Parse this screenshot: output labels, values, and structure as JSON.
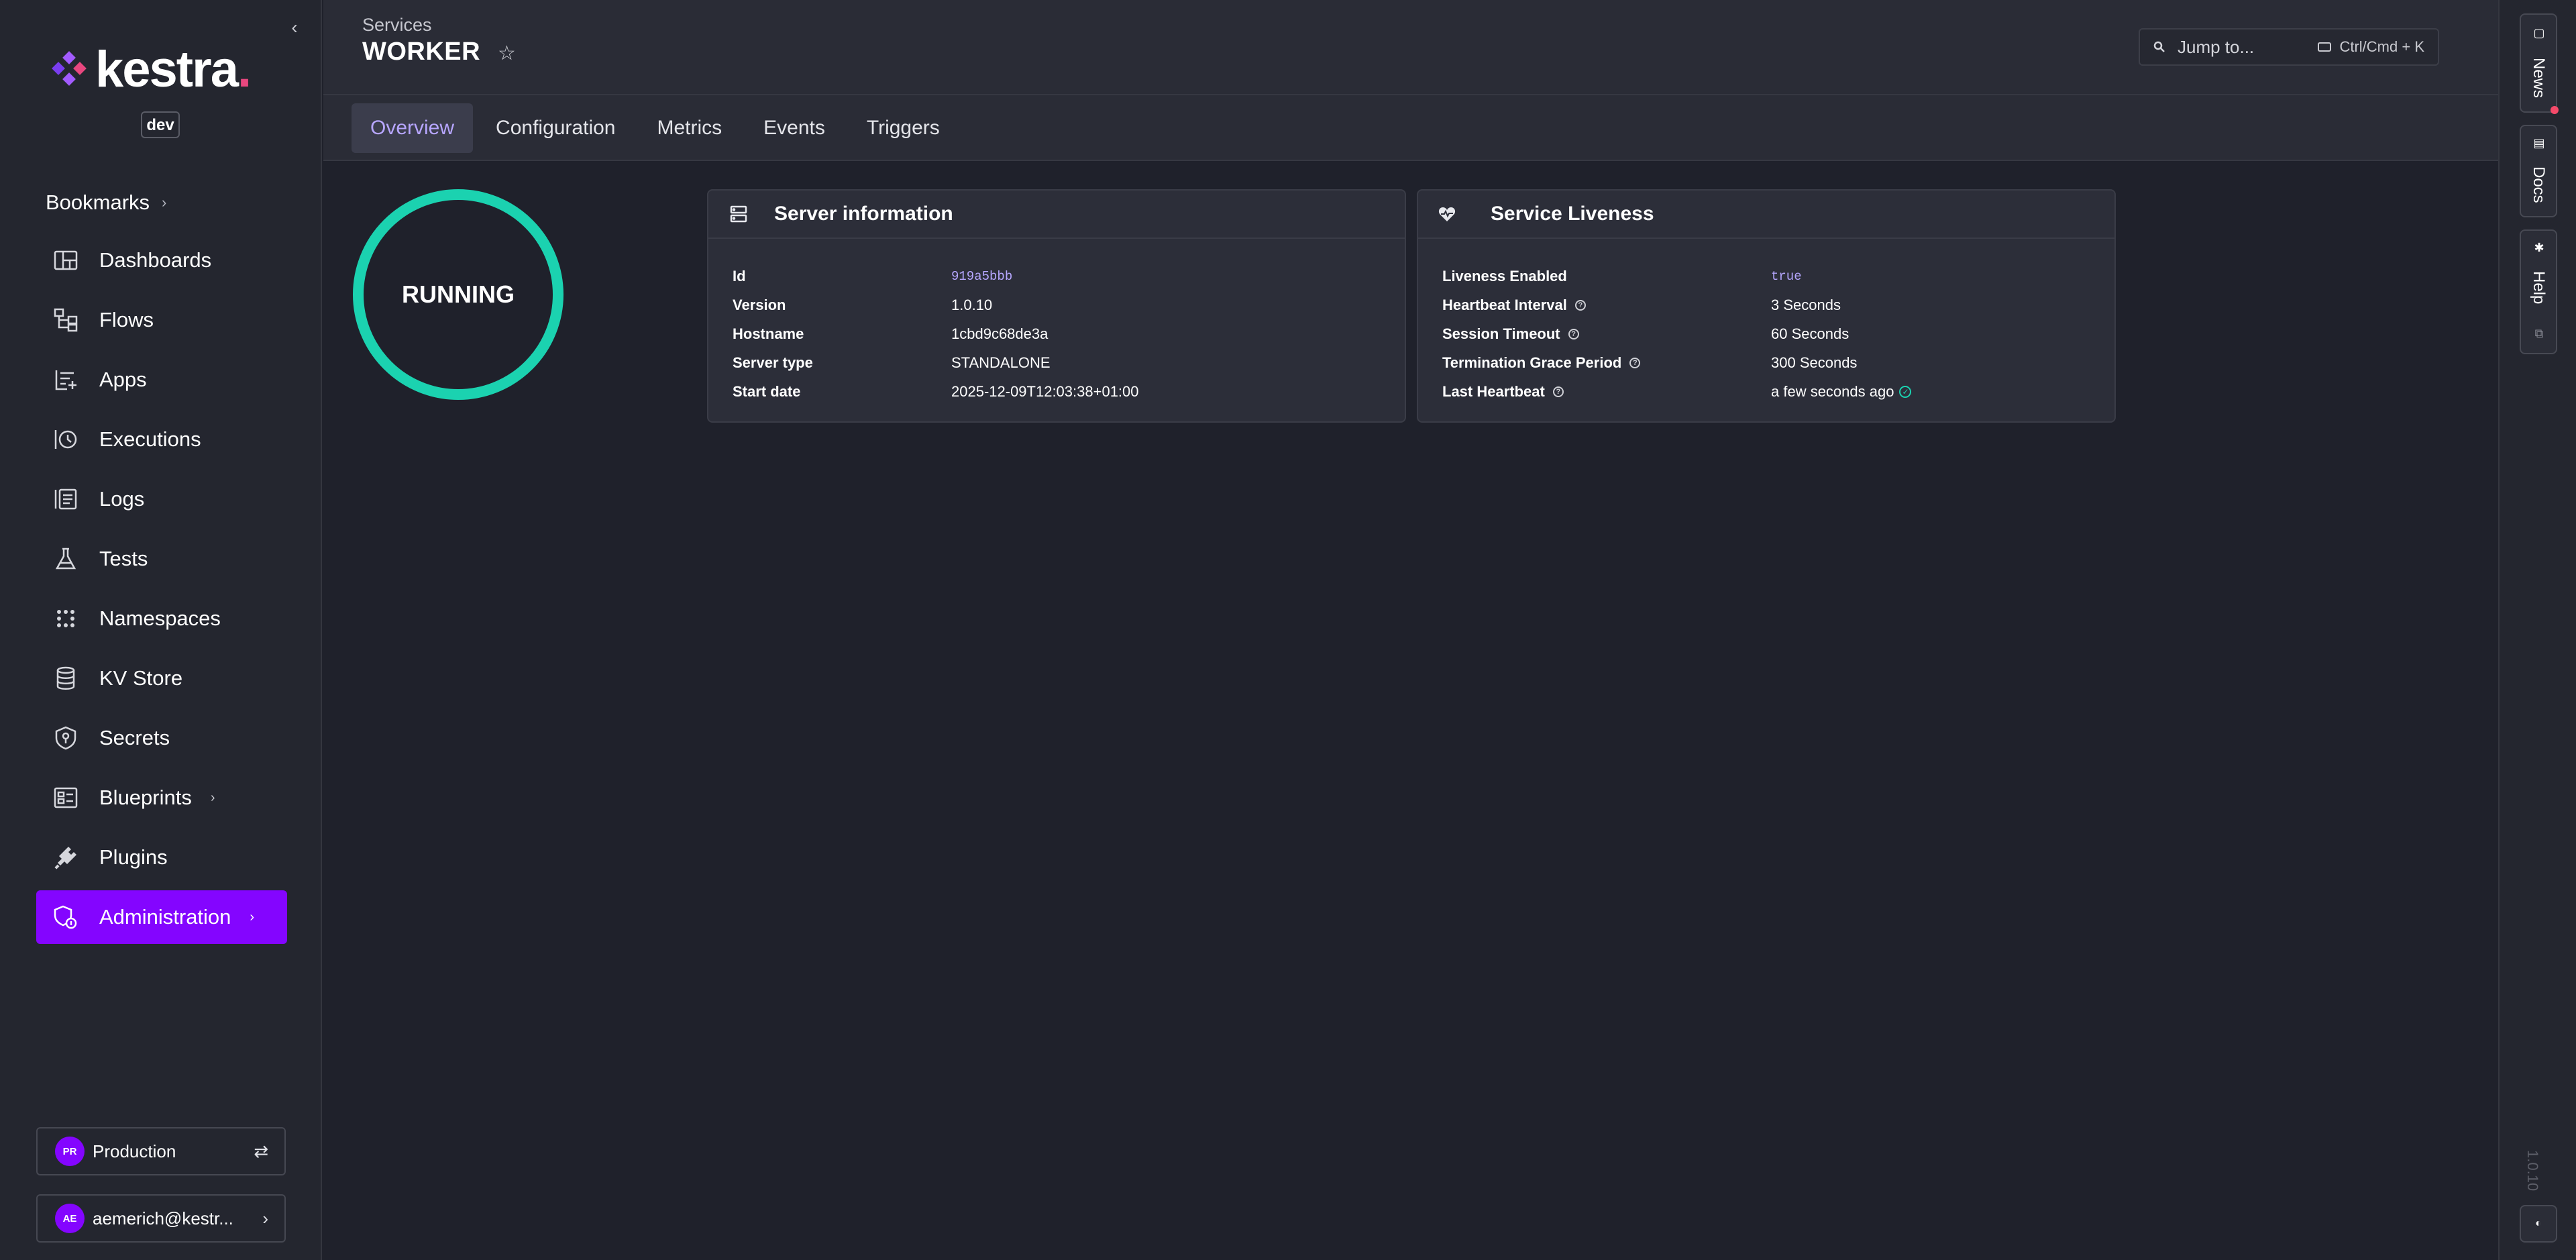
{
  "sidebar": {
    "logo_text": "kestra",
    "env_badge": "dev",
    "bookmarks_label": "Bookmarks",
    "items": [
      {
        "label": "Dashboards",
        "icon": "dashboard-icon"
      },
      {
        "label": "Flows",
        "icon": "flow-icon"
      },
      {
        "label": "Apps",
        "icon": "apps-icon"
      },
      {
        "label": "Executions",
        "icon": "history-icon"
      },
      {
        "label": "Logs",
        "icon": "logs-icon"
      },
      {
        "label": "Tests",
        "icon": "flask-icon"
      },
      {
        "label": "Namespaces",
        "icon": "grid-dots-icon"
      },
      {
        "label": "KV Store",
        "icon": "database-icon"
      },
      {
        "label": "Secrets",
        "icon": "shield-key-icon"
      },
      {
        "label": "Blueprints",
        "icon": "blueprint-icon"
      },
      {
        "label": "Plugins",
        "icon": "plug-icon"
      },
      {
        "label": "Administration",
        "icon": "shield-admin-icon"
      }
    ],
    "tenant": {
      "initials": "PR",
      "name": "Production"
    },
    "user": {
      "initials": "AE",
      "name": "aemerich@kestr..."
    }
  },
  "header": {
    "breadcrumb": "Services",
    "title": "WORKER",
    "search": {
      "placeholder": "Jump to...",
      "shortcut": "Ctrl/Cmd + K"
    }
  },
  "tabs": [
    "Overview",
    "Configuration",
    "Metrics",
    "Events",
    "Triggers"
  ],
  "status": {
    "label": "RUNNING",
    "color": "#1bd2b0"
  },
  "server_info": {
    "title": "Server information",
    "rows": [
      {
        "key": "Id",
        "value": "919a5bbb"
      },
      {
        "key": "Version",
        "value": "1.0.10"
      },
      {
        "key": "Hostname",
        "value": "1cbd9c68de3a"
      },
      {
        "key": "Server type",
        "value": "STANDALONE"
      },
      {
        "key": "Start date",
        "value": "2025-12-09T12:03:38+01:00"
      }
    ]
  },
  "liveness": {
    "title": "Service Liveness",
    "rows": [
      {
        "key": "Liveness Enabled",
        "value": "true"
      },
      {
        "key": "Heartbeat Interval",
        "value": "3 Seconds"
      },
      {
        "key": "Session Timeout",
        "value": "60 Seconds"
      },
      {
        "key": "Termination Grace Period",
        "value": "300 Seconds"
      },
      {
        "key": "Last Heartbeat",
        "value": "a few seconds ago"
      }
    ]
  },
  "rail": {
    "news": "News",
    "docs": "Docs",
    "help": "Help",
    "version": "1.0.10"
  },
  "colors": {
    "accent": "#8405ff",
    "running": "#1bd2b0",
    "tab_active": "#b7a6ff",
    "notification": "#f54a6a"
  }
}
